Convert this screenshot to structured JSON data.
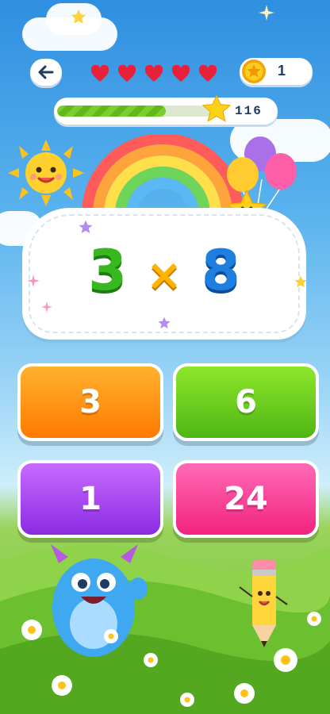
{
  "hud": {
    "back_icon": "arrow-left-icon",
    "lives": 5,
    "heart_color": "#e8203a",
    "coin_count": "1",
    "progress_fraction": 0.7,
    "score": "116"
  },
  "problem": {
    "left": "3",
    "operator": "×",
    "right": "8"
  },
  "answers": [
    {
      "label": "3",
      "color": "#ff8a00"
    },
    {
      "label": "6",
      "color": "#5cc01a"
    },
    {
      "label": "1",
      "color": "#9b3cf0"
    },
    {
      "label": "24",
      "color": "#f7348a"
    }
  ]
}
